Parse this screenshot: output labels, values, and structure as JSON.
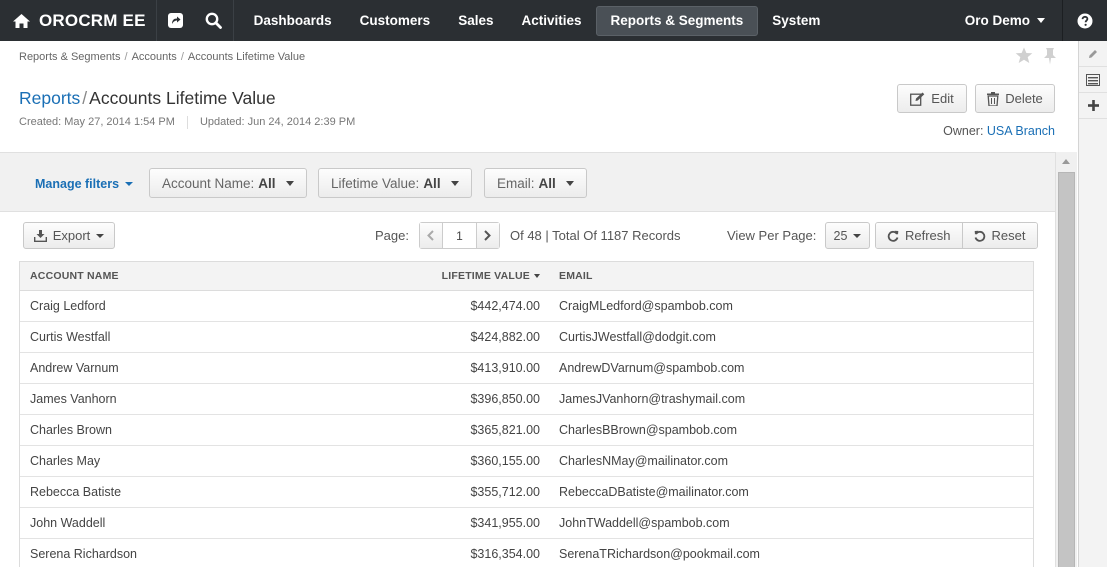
{
  "app": {
    "brand": "OROCRM EE"
  },
  "nav": {
    "items": [
      "Dashboards",
      "Customers",
      "Sales",
      "Activities",
      "Reports & Segments",
      "System"
    ],
    "active": "Reports & Segments",
    "user": "Oro Demo"
  },
  "breadcrumb": [
    "Reports & Segments",
    "Accounts",
    "Accounts Lifetime Value"
  ],
  "page": {
    "title_prefix": "Reports",
    "title": "Accounts Lifetime Value",
    "created": "Created: May 27, 2014 1:54 PM",
    "updated": "Updated: Jun 24, 2014 2:39 PM",
    "owner_label": "Owner:",
    "owner": "USA Branch",
    "edit_label": "Edit",
    "delete_label": "Delete"
  },
  "filters": {
    "manage_label": "Manage filters",
    "items": [
      {
        "label": "Account Name:",
        "value": "All"
      },
      {
        "label": "Lifetime Value:",
        "value": "All"
      },
      {
        "label": "Email:",
        "value": "All"
      }
    ]
  },
  "toolbar": {
    "export_label": "Export",
    "page_label": "Page:",
    "page": "1",
    "page_info": "Of 48 | Total Of 1187 Records",
    "view_per_page_label": "View Per Page:",
    "per_page": "25",
    "refresh_label": "Refresh",
    "reset_label": "Reset"
  },
  "grid": {
    "columns": [
      "Account Name",
      "Lifetime Value",
      "Email"
    ],
    "sorted_column": "Lifetime Value",
    "sort_direction": "desc",
    "rows": [
      [
        "Craig Ledford",
        "$442,474.00",
        "CraigMLedford@spambob.com"
      ],
      [
        "Curtis Westfall",
        "$424,882.00",
        "CurtisJWestfall@dodgit.com"
      ],
      [
        "Andrew Varnum",
        "$413,910.00",
        "AndrewDVarnum@spambob.com"
      ],
      [
        "James Vanhorn",
        "$396,850.00",
        "JamesJVanhorn@trashymail.com"
      ],
      [
        "Charles Brown",
        "$365,821.00",
        "CharlesBBrown@spambob.com"
      ],
      [
        "Charles May",
        "$360,155.00",
        "CharlesNMay@mailinator.com"
      ],
      [
        "Rebecca Batiste",
        "$355,712.00",
        "RebeccaDBatiste@mailinator.com"
      ],
      [
        "John Waddell",
        "$341,955.00",
        "JohnTWaddell@spambob.com"
      ],
      [
        "Serena Richardson",
        "$316,354.00",
        "SerenaTRichardson@pookmail.com"
      ]
    ]
  },
  "colors": {
    "topbar": "#2b2f33",
    "link": "#1a6fb5",
    "filterband": "#f1f1f1"
  }
}
